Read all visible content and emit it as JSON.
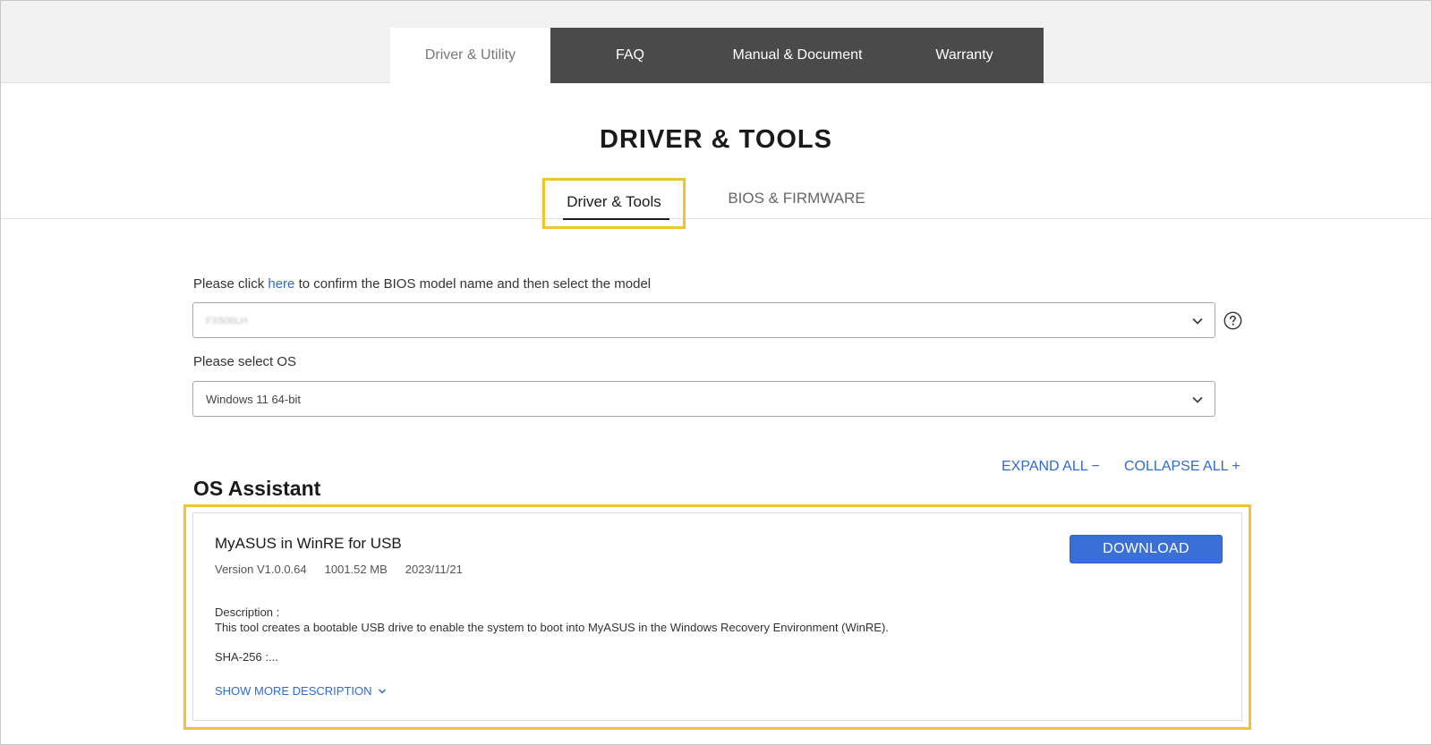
{
  "top_tabs": [
    {
      "label": "Driver & Utility",
      "active": true
    },
    {
      "label": "FAQ",
      "active": false
    },
    {
      "label": "Manual & Document",
      "active": false
    },
    {
      "label": "Warranty",
      "active": false
    }
  ],
  "page_title": "DRIVER & TOOLS",
  "sub_tabs": [
    {
      "label": "Driver & Tools",
      "active": true
    },
    {
      "label": "BIOS & FIRMWARE",
      "active": false
    }
  ],
  "bios_prompt": {
    "before": "Please click ",
    "link": "here",
    "after": " to confirm the BIOS model name and then select the model"
  },
  "model_select": {
    "value": "FX506LH",
    "icon": "chevron-down-icon"
  },
  "os_label": "Please select OS",
  "os_select": {
    "value": "Windows 11 64-bit",
    "icon": "chevron-down-icon"
  },
  "controls": {
    "expand_all": "EXPAND ALL",
    "collapse_all": "COLLAPSE ALL"
  },
  "section_title": "OS Assistant",
  "item": {
    "title": "MyASUS in WinRE for USB",
    "version": "Version V1.0.0.64",
    "size": "1001.52 MB",
    "date": "2023/11/21",
    "download_label": "DOWNLOAD",
    "description_label": "Description :",
    "description": "This tool creates a bootable USB drive to enable the system to boot into MyASUS in the Windows Recovery Environment (WinRE).",
    "sha": "SHA-256 :...",
    "show_more": "SHOW MORE DESCRIPTION"
  },
  "colors": {
    "accent_blue": "#2d6bdc",
    "highlight_yellow": "#f5c22b",
    "tab_dark": "#4a4a4a"
  }
}
